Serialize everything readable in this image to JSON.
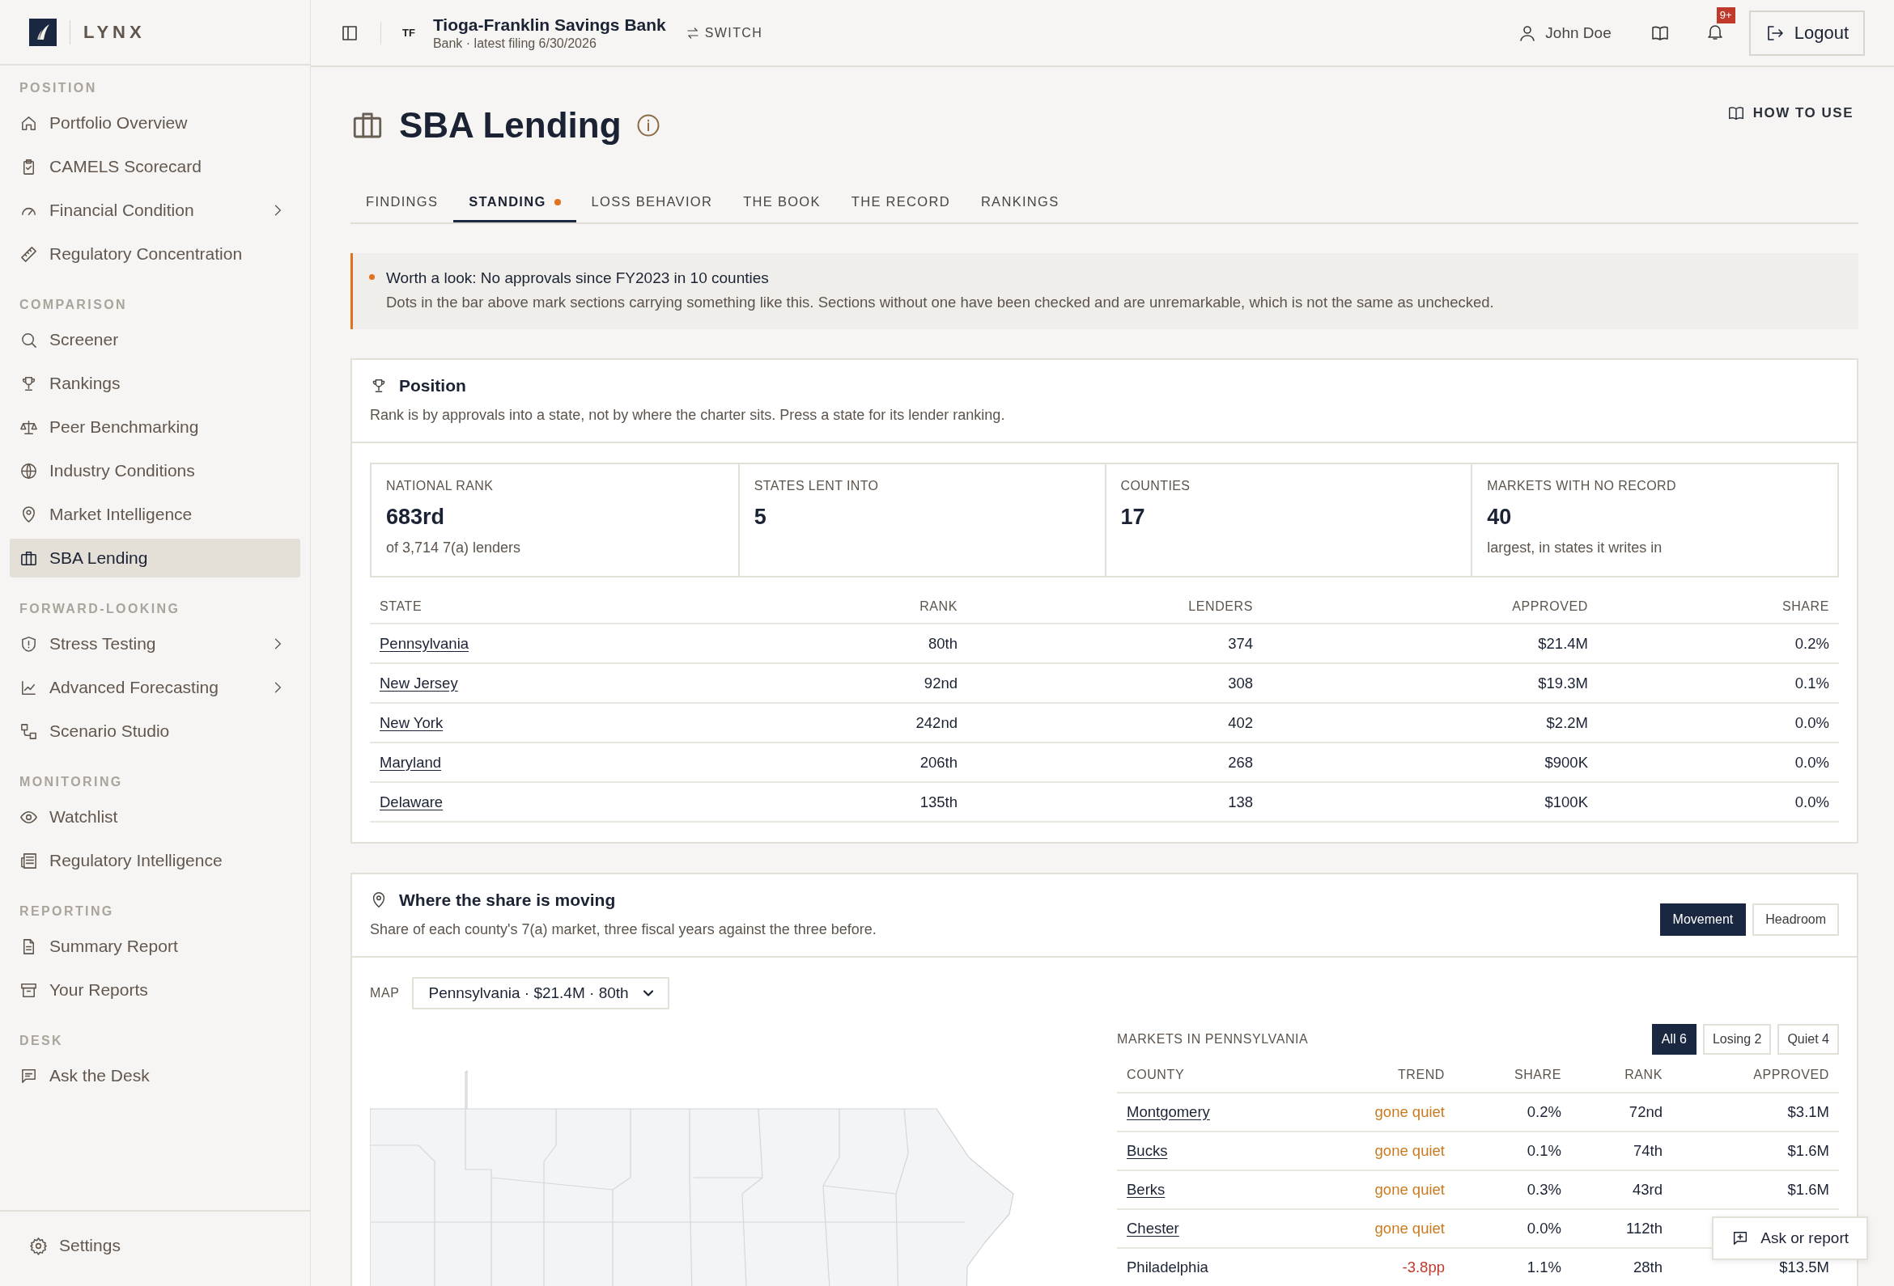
{
  "sidebar": {
    "brand": "LYNX",
    "sections": [
      {
        "label": "POSITION",
        "items": [
          {
            "label": "Portfolio Overview",
            "selected": false,
            "expandable": false
          },
          {
            "label": "CAMELS Scorecard",
            "selected": false,
            "expandable": false
          },
          {
            "label": "Financial Condition",
            "selected": false,
            "expandable": true
          },
          {
            "label": "Regulatory Concentration",
            "selected": false,
            "expandable": false
          }
        ]
      },
      {
        "label": "COMPARISON",
        "items": [
          {
            "label": "Screener",
            "selected": false,
            "expandable": false
          },
          {
            "label": "Rankings",
            "selected": false,
            "expandable": false
          },
          {
            "label": "Peer Benchmarking",
            "selected": false,
            "expandable": false
          },
          {
            "label": "Industry Conditions",
            "selected": false,
            "expandable": false
          },
          {
            "label": "Market Intelligence",
            "selected": false,
            "expandable": false
          },
          {
            "label": "SBA Lending",
            "selected": true,
            "expandable": false
          }
        ]
      },
      {
        "label": "FORWARD-LOOKING",
        "items": [
          {
            "label": "Stress Testing",
            "selected": false,
            "expandable": true
          },
          {
            "label": "Advanced Forecasting",
            "selected": false,
            "expandable": true
          },
          {
            "label": "Scenario Studio",
            "selected": false,
            "expandable": false
          }
        ]
      },
      {
        "label": "MONITORING",
        "items": [
          {
            "label": "Watchlist",
            "selected": false,
            "expandable": false
          },
          {
            "label": "Regulatory Intelligence",
            "selected": false,
            "expandable": false
          }
        ]
      },
      {
        "label": "REPORTING",
        "items": [
          {
            "label": "Summary Report",
            "selected": false,
            "expandable": false
          },
          {
            "label": "Your Reports",
            "selected": false,
            "expandable": false
          }
        ]
      },
      {
        "label": "DESK",
        "items": [
          {
            "label": "Ask the Desk",
            "selected": false,
            "expandable": false
          }
        ]
      }
    ],
    "footer": "Settings"
  },
  "header": {
    "bank_initials": "TF",
    "bank_name": "Tioga-Franklin Savings Bank",
    "bank_meta": "Bank · latest filing 6/30/2026",
    "switch": "SWITCH",
    "user": "John Doe",
    "notifications": "9+",
    "logout": "Logout"
  },
  "page": {
    "title": "SBA Lending",
    "how_to_use": "HOW TO USE",
    "tabs": [
      {
        "label": "FINDINGS",
        "selected": false,
        "flagged": false
      },
      {
        "label": "STANDING",
        "selected": true,
        "flagged": true
      },
      {
        "label": "LOSS BEHAVIOR",
        "selected": false,
        "flagged": false
      },
      {
        "label": "THE BOOK",
        "selected": false,
        "flagged": false
      },
      {
        "label": "THE RECORD",
        "selected": false,
        "flagged": false
      },
      {
        "label": "RANKINGS",
        "selected": false,
        "flagged": false
      }
    ]
  },
  "alert": {
    "title": "Worth a look: No approvals since FY2023 in 10 counties",
    "body": "Dots in the bar above mark sections carrying something like this. Sections without one have been checked and are unremarkable, which is not the same as unchecked."
  },
  "position": {
    "title": "Position",
    "subtitle": "Rank is by approvals into a state, not by where the charter sits. Press a state for its lender ranking.",
    "stats": [
      {
        "label": "NATIONAL RANK",
        "value": "683rd",
        "note": "of 3,714 7(a) lenders"
      },
      {
        "label": "STATES LENT INTO",
        "value": "5"
      },
      {
        "label": "COUNTIES",
        "value": "17"
      },
      {
        "label": "MARKETS WITH NO RECORD",
        "value": "40",
        "note": "largest, in states it writes in"
      }
    ],
    "table": {
      "columns": [
        "STATE",
        "RANK",
        "LENDERS",
        "APPROVED",
        "SHARE"
      ],
      "rows": [
        [
          "Pennsylvania",
          "80th",
          "374",
          "$21.4M",
          "0.2%"
        ],
        [
          "New Jersey",
          "92nd",
          "308",
          "$19.3M",
          "0.1%"
        ],
        [
          "New York",
          "242nd",
          "402",
          "$2.2M",
          "0.0%"
        ],
        [
          "Maryland",
          "206th",
          "268",
          "$900K",
          "0.0%"
        ],
        [
          "Delaware",
          "135th",
          "138",
          "$100K",
          "0.0%"
        ]
      ]
    }
  },
  "share": {
    "title": "Where the share is moving",
    "subtitle": "Share of each county's 7(a) market, three fiscal years against the three before.",
    "modes": [
      {
        "label": "Movement",
        "selected": true
      },
      {
        "label": "Headroom",
        "selected": false
      }
    ],
    "map_label": "MAP",
    "map_select": "Pennsylvania · $21.4M · 80th",
    "markets_title": "MARKETS IN PENNSYLVANIA",
    "filters": [
      {
        "label": "All 6",
        "selected": true
      },
      {
        "label": "Losing 2",
        "selected": false
      },
      {
        "label": "Quiet 4",
        "selected": false
      }
    ],
    "columns": [
      "COUNTY",
      "TREND",
      "SHARE",
      "RANK",
      "APPROVED"
    ],
    "rows": [
      {
        "county": "Montgomery",
        "linked": true,
        "trend": "gone quiet",
        "kind": "quiet",
        "share": "0.2%",
        "rank": "72nd",
        "approved": "$3.1M"
      },
      {
        "county": "Bucks",
        "linked": true,
        "trend": "gone quiet",
        "kind": "quiet",
        "share": "0.1%",
        "rank": "74th",
        "approved": "$1.6M"
      },
      {
        "county": "Berks",
        "linked": true,
        "trend": "gone quiet",
        "kind": "quiet",
        "share": "0.3%",
        "rank": "43rd",
        "approved": "$1.6M"
      },
      {
        "county": "Chester",
        "linked": true,
        "trend": "gone quiet",
        "kind": "quiet",
        "share": "0.0%",
        "rank": "112th"
      },
      {
        "county": "Philadelphia",
        "linked": false,
        "trend": "-3.8pp",
        "kind": "losing",
        "share": "1.1%",
        "rank": "28th",
        "approved": "$13.5M"
      }
    ]
  },
  "ask_button": "Ask or report"
}
